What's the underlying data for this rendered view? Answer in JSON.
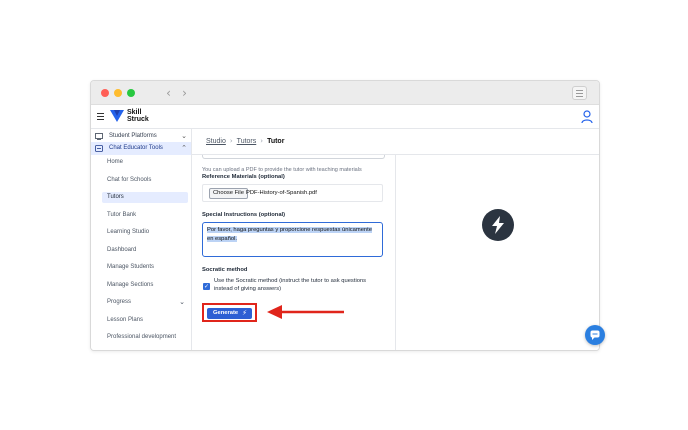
{
  "window": {
    "back_glyph": "‹",
    "forward_glyph": "›"
  },
  "app": {
    "brand_line1": "Skill",
    "brand_line2": "Struck",
    "icons": [
      "hamburger-icon",
      "skillstruck-logo",
      "user-icon"
    ]
  },
  "sidebar": {
    "sections": [
      {
        "label": "Student Platforms",
        "chevron": "⌄",
        "icon": "monitor-icon"
      },
      {
        "label": "Chat Educator Tools",
        "chevron": "⌃",
        "icon": "chat-tools-icon"
      }
    ],
    "items": [
      {
        "label": "Home"
      },
      {
        "label": "Chat for Schools"
      },
      {
        "label": "Tutors"
      },
      {
        "label": "Tutor Bank"
      },
      {
        "label": "Learning Studio"
      },
      {
        "label": "Dashboard"
      },
      {
        "label": "Manage Students"
      },
      {
        "label": "Manage Sections"
      },
      {
        "label": "Progress",
        "chevron": "⌄"
      },
      {
        "label": "Lesson Plans"
      },
      {
        "label": "Professional development"
      }
    ],
    "active_item": "Tutors"
  },
  "breadcrumb": {
    "items": [
      "Studio",
      "Tutors",
      "Tutor"
    ],
    "separator": "›"
  },
  "form": {
    "upload_hint": "You can upload a PDF to provide the tutor with teaching materials",
    "reference_label": "Reference Materials (optional)",
    "choose_file_label": "Choose File",
    "file_name": "PDF-History-of-Spanish.pdf",
    "instructions_label": "Special Instructions (optional)",
    "instructions_value": "Por favor, haga preguntas y proporcione respuestas únicamente en español.",
    "socratic_label": "Socratic method",
    "socratic_checkbox_text": "Use the Socratic method (instruct the tutor to ask questions instead of giving answers)",
    "socratic_checked": true,
    "check_glyph": "✓",
    "generate_label": "Generate",
    "generate_icon": "⚡"
  },
  "annotation": {
    "highlight_color": "#e0251b",
    "arrow_color": "#e0251b"
  },
  "colors": {
    "primary": "#2d5fd3",
    "active_bg": "#e5ecff",
    "preview_bg": "#2b3440",
    "chat_fab": "#2b7fe0"
  }
}
